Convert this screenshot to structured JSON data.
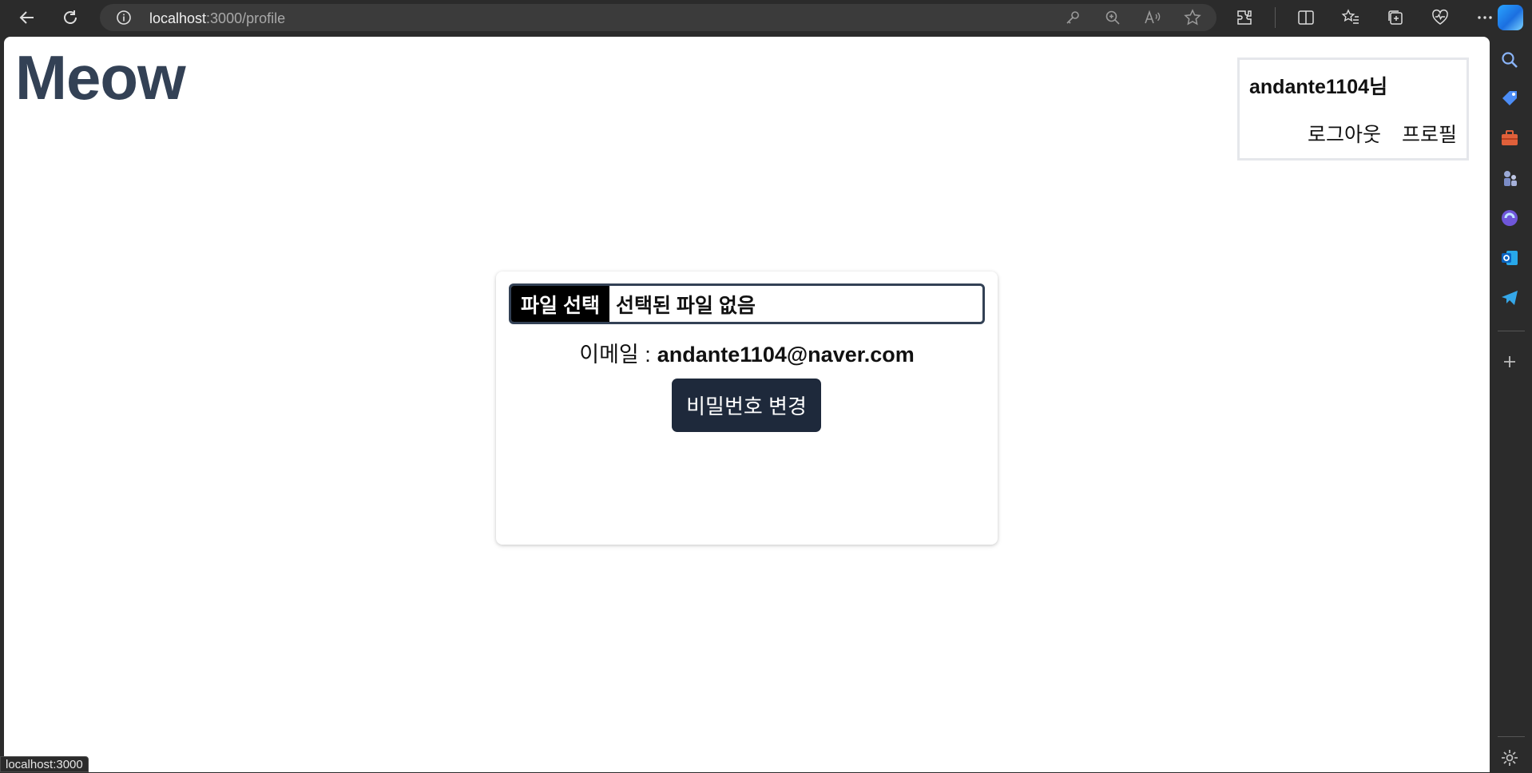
{
  "browser": {
    "url_host": "localhost",
    "url_path": ":3000/profile",
    "status_url": "localhost:3000"
  },
  "page": {
    "logo": "Meow",
    "user": {
      "name": "andante1104님",
      "logout": "로그아웃",
      "profile": "프로필"
    },
    "profile_card": {
      "file_button": "파일 선택",
      "file_status": "선택된 파일 없음",
      "email_label": "이메일 :",
      "email_value": "andante1104@naver.com",
      "change_password": "비밀번호 변경"
    }
  },
  "colors": {
    "logo": "#334155",
    "button_dark": "#1e293b",
    "chrome_bg": "#2b2b2b"
  }
}
